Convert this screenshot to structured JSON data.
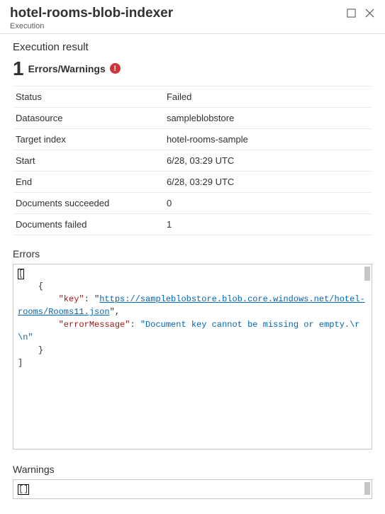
{
  "header": {
    "title": "hotel-rooms-blob-indexer",
    "subtitle": "Execution"
  },
  "result": {
    "section_title": "Execution result",
    "count": "1",
    "label": "Errors/Warnings",
    "alert_symbol": "!"
  },
  "details": [
    {
      "key": "Status",
      "value": "Failed"
    },
    {
      "key": "Datasource",
      "value": "sampleblobstore"
    },
    {
      "key": "Target index",
      "value": "hotel-rooms-sample"
    },
    {
      "key": "Start",
      "value": "6/28, 03:29 UTC"
    },
    {
      "key": "End",
      "value": "6/28, 03:29 UTC"
    },
    {
      "key": "Documents succeeded",
      "value": "0"
    },
    {
      "key": "Documents failed",
      "value": "1"
    }
  ],
  "errors": {
    "title": "Errors",
    "open": "[",
    "brace_open": "{",
    "key_label": "\"key\"",
    "key_sep": ": ",
    "url_q1": "\"",
    "url": "https://sampleblobstore.blob.core.windows.net/hotel-rooms/Rooms11.json",
    "url_q2": "\"",
    "comma": ",",
    "err_label": "\"errorMessage\"",
    "err_sep": ": ",
    "err_value": "\"Document key cannot be missing or empty.\\r\\n\"",
    "brace_close": "}",
    "close": "]"
  },
  "warnings": {
    "title": "Warnings",
    "content": "[]"
  }
}
